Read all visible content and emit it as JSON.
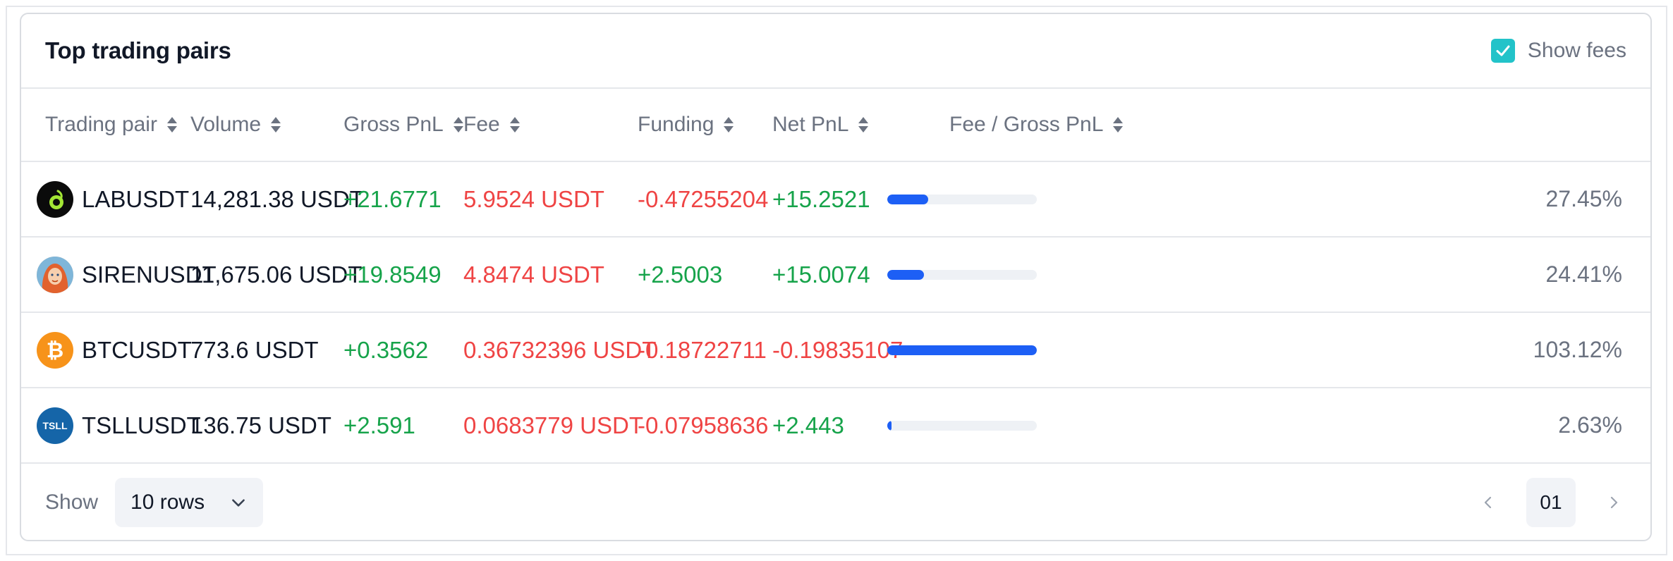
{
  "header": {
    "title": "Top trading pairs",
    "show_fees_label": "Show fees",
    "show_fees_checked": true
  },
  "columns": {
    "pair": "Trading pair",
    "volume": "Volume",
    "gross": "Gross PnL",
    "fee": "Fee",
    "funding": "Funding",
    "net": "Net PnL",
    "ratio": "Fee / Gross PnL"
  },
  "rows": [
    {
      "pair": "LABUSDT",
      "icon": "lab-token-icon",
      "volume": "14,281.38 USDT",
      "gross": "+21.6771",
      "fee": "5.9524 USDT",
      "funding": "-0.47255204",
      "net": "+15.2521",
      "ratio_pct": 27.45,
      "ratio": "27.45%"
    },
    {
      "pair": "SIRENUSDT",
      "icon": "siren-token-icon",
      "volume": "11,675.06 USDT",
      "gross": "+19.8549",
      "fee": "4.8474 USDT",
      "funding": "+2.5003",
      "net": "+15.0074",
      "ratio_pct": 24.41,
      "ratio": "24.41%"
    },
    {
      "pair": "BTCUSDT",
      "icon": "bitcoin-icon",
      "volume": "773.6 USDT",
      "gross": "+0.3562",
      "fee": "0.36732396 USDT",
      "funding": "-0.18722711",
      "net": "-0.19835107",
      "ratio_pct": 103.12,
      "ratio": "103.12%"
    },
    {
      "pair": "TSLLUSDT",
      "icon": "tsll-token-icon",
      "volume": "136.75 USDT",
      "gross": "+2.591",
      "fee": "0.0683779 USDT",
      "funding": "-0.07958636",
      "net": "+2.443",
      "ratio_pct": 2.63,
      "ratio": "2.63%"
    }
  ],
  "icons": {
    "tsll_text": "TSLL"
  },
  "footer": {
    "show_label": "Show",
    "rows_select": "10 rows",
    "page": "01"
  },
  "colors": {
    "accent": "#22c3c9",
    "bar": "#1d5ff5",
    "positive": "#16a34a",
    "negative": "#ef4444"
  }
}
